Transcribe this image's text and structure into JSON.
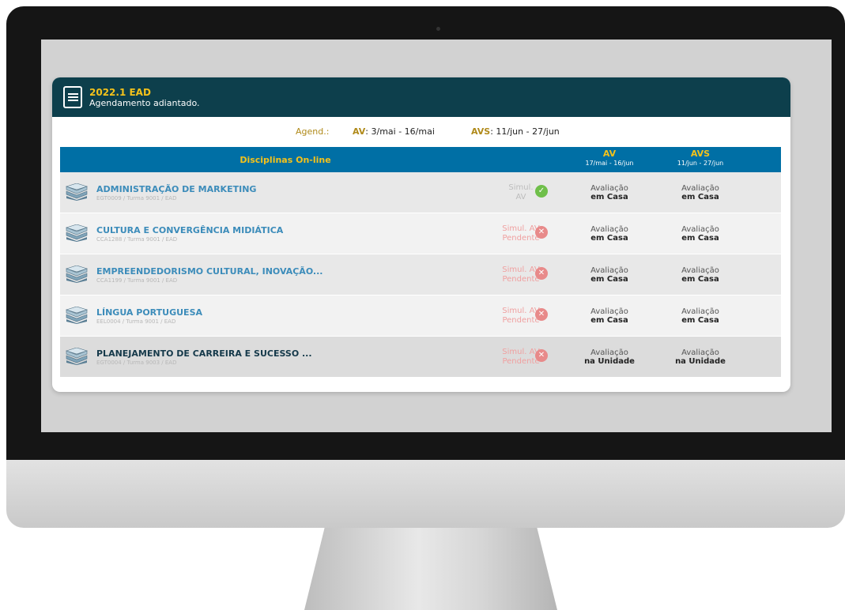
{
  "header": {
    "title": "2022.1 EAD",
    "subtitle": "Agendamento adiantado."
  },
  "schedule": {
    "label": "Agend.:",
    "av_label": "AV",
    "av_dates": ": 3/mai - 16/mai",
    "avs_label": "AVS",
    "avs_dates": ": 11/jun - 27/jun"
  },
  "table": {
    "col_disciplines": "Disciplinas On-line",
    "col_av": "AV",
    "col_av_dates": "17/mai - 16/jun",
    "col_avs": "AVS",
    "col_avs_dates": "11/jun - 27/jun",
    "rows": [
      {
        "name": "ADMINISTRAÇÃO DE MARKETING",
        "code": "EGT0009 / Turma 9001 / EAD",
        "simul_line1": "Simul.",
        "simul_line2": "AV",
        "simul_status": "ok",
        "av_line1": "Avaliação",
        "av_line2": "em Casa",
        "avs_line1": "Avaliação",
        "avs_line2": "em Casa"
      },
      {
        "name": "CULTURA E CONVERGÊNCIA MIDIÁTICA",
        "code": "CCA1288 / Turma 9001 / EAD",
        "simul_line1": "Simul. AV",
        "simul_line2": "Pendente",
        "simul_status": "pending",
        "av_line1": "Avaliação",
        "av_line2": "em Casa",
        "avs_line1": "Avaliação",
        "avs_line2": "em Casa"
      },
      {
        "name": "EMPREENDEDORISMO CULTURAL, INOVAÇÃO...",
        "code": "CCA1199 / Turma 9001 / EAD",
        "simul_line1": "Simul. AV",
        "simul_line2": "Pendente",
        "simul_status": "pending",
        "av_line1": "Avaliação",
        "av_line2": "em Casa",
        "avs_line1": "Avaliação",
        "avs_line2": "em Casa"
      },
      {
        "name": "LÍNGUA PORTUGUESA",
        "code": "EEL0004 / Turma 9001 / EAD",
        "simul_line1": "Simul. AV",
        "simul_line2": "Pendente",
        "simul_status": "pending",
        "av_line1": "Avaliação",
        "av_line2": "em Casa",
        "avs_line1": "Avaliação",
        "avs_line2": "em Casa"
      },
      {
        "name": "PLANEJAMENTO DE CARREIRA E SUCESSO ...",
        "code": "EGT0004 / Turma 9003 / EAD",
        "simul_line1": "Simul. AV",
        "simul_line2": "Pendente",
        "simul_status": "pending",
        "av_line1": "Avaliação",
        "av_line2": "na Unidade",
        "avs_line1": "Avaliação",
        "avs_line2": "na Unidade"
      }
    ]
  },
  "colors": {
    "header_bg": "#0d3f4c",
    "table_header_bg": "#006fa5",
    "accent_yellow": "#f4c21b",
    "subject_blue": "#3c8cba",
    "ok_green": "#6fbf4a",
    "pending_red": "#e88a8a"
  },
  "icons": {
    "header": "clipboard-checklist-icon",
    "row": "books-icon",
    "ok": "check-circle-icon",
    "pending": "x-circle-icon"
  }
}
